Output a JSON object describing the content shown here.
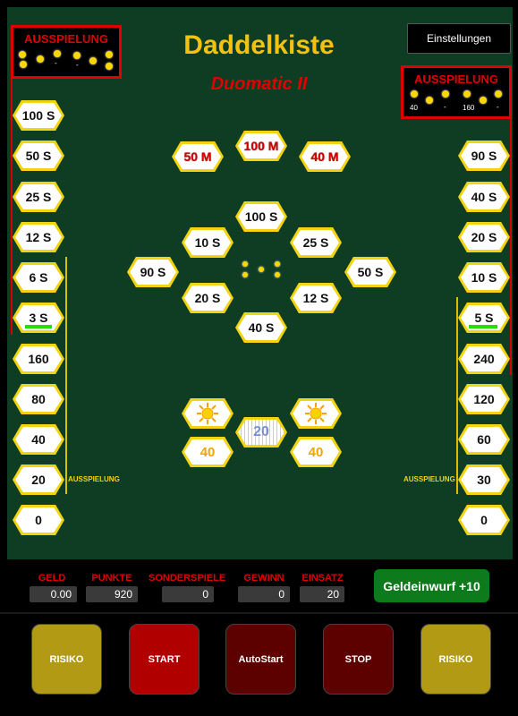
{
  "header": {
    "title": "Daddelkiste",
    "subtitle": "Duomatic II",
    "settings_label": "Einstellungen"
  },
  "ausspielung_left": {
    "label": "AUSSPIELUNG",
    "slots": [
      "",
      "",
      "",
      "-",
      "",
      "-",
      "",
      ""
    ]
  },
  "ausspielung_right": {
    "label": "AUSSPIELUNG",
    "slots": [
      "40",
      "",
      "-",
      "",
      "160",
      "",
      "-"
    ]
  },
  "left_ladder": [
    "100 S",
    "50 S",
    "25 S",
    "12 S",
    "6 S",
    "3 S",
    "160",
    "80",
    "40",
    "20",
    "0"
  ],
  "right_ladder": [
    "90 S",
    "40 S",
    "20 S",
    "10 S",
    "5 S",
    "240",
    "120",
    "60",
    "30",
    "0"
  ],
  "left_ladder_label": "AUSSPIELUNG",
  "right_ladder_label": "AUSSPIELUNG",
  "top_row": [
    "50 M",
    "100 M",
    "40 M"
  ],
  "wheel": {
    "top": "100 S",
    "upper_left": "10 S",
    "upper_right": "25 S",
    "left": "90 S",
    "right": "50 S",
    "lower_left": "20 S",
    "lower_right": "12 S",
    "bottom": "40 S"
  },
  "reels": {
    "left_value": "40",
    "right_value": "40",
    "center_value": "20",
    "left_symbol": "sun-icon",
    "right_symbol": "sun-icon"
  },
  "stats": {
    "geld_label": "GELD",
    "geld_value": "0.00",
    "punkte_label": "PUNKTE",
    "punkte_value": "920",
    "sonderspiele_label": "SONDERSPIELE",
    "sonderspiele_value": "0",
    "gewinn_label": "GEWINN",
    "gewinn_value": "0",
    "einsatz_label": "EINSATZ",
    "einsatz_value": "20"
  },
  "geldeinwurf_label": "Geldeinwurf +10",
  "buttons": {
    "risiko_left": "RISIKO",
    "start": "START",
    "autostart": "AutoStart",
    "stop": "STOP",
    "risiko_right": "RISIKO"
  },
  "colors": {
    "board": "#0e3d23",
    "gold": "#f3d411",
    "red": "#e00000",
    "underline": "#22e000"
  }
}
